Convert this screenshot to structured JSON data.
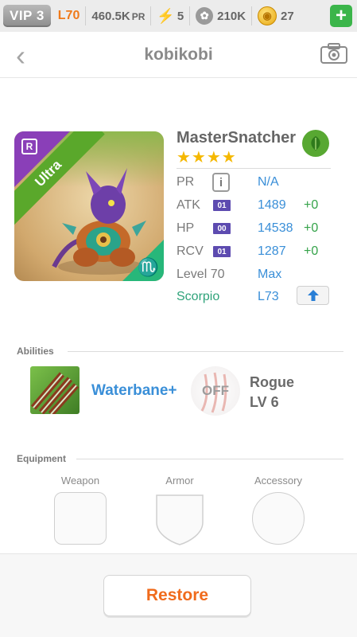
{
  "topbar": {
    "vip": "VIP 3",
    "level": "L70",
    "power": "460.5K",
    "power_unit": "PR",
    "energy": "5",
    "paw_count": "210K",
    "coins": "27",
    "plus_label": "+"
  },
  "header": {
    "title": "kobikobi",
    "back_icon": "chevron-left-icon",
    "camera_icon": "camera-icon"
  },
  "pet": {
    "rarity_badge": "R",
    "rarity": "Ultra",
    "zodiac_glyph": "♏",
    "name": "MasterSnatcher",
    "stars": "★★★★",
    "star_count": 4,
    "element_icon": "leaf-icon",
    "stats": {
      "pr": {
        "label": "PR",
        "value": "N/A",
        "icon": "i"
      },
      "atk": {
        "label": "ATK",
        "tag": "01",
        "value": "1489",
        "bonus": "+0"
      },
      "hp": {
        "label": "HP",
        "tag": "00",
        "value": "14538",
        "bonus": "+0"
      },
      "rcv": {
        "label": "RCV",
        "tag": "01",
        "value": "1287",
        "bonus": "+0"
      },
      "level": {
        "label": "Level 70",
        "value": "Max"
      },
      "sign": {
        "label": "Scorpio",
        "value": "L73"
      }
    }
  },
  "abilities": {
    "title": "Abilities",
    "primary": "Waterbane+",
    "secondary_state": "OFF",
    "secondary_name": "Rogue",
    "secondary_level": "LV 6"
  },
  "equipment": {
    "title": "Equipment",
    "slots": [
      "Weapon",
      "Armor",
      "Accessory"
    ]
  },
  "actions": {
    "restore": "Restore"
  },
  "colors": {
    "accent_blue": "#3a8fd8",
    "bonus_green": "#35a34a",
    "restore_orange": "#f06b1c",
    "ultra_green": "#5aa82b",
    "rare_purple": "#8a3fb8"
  }
}
